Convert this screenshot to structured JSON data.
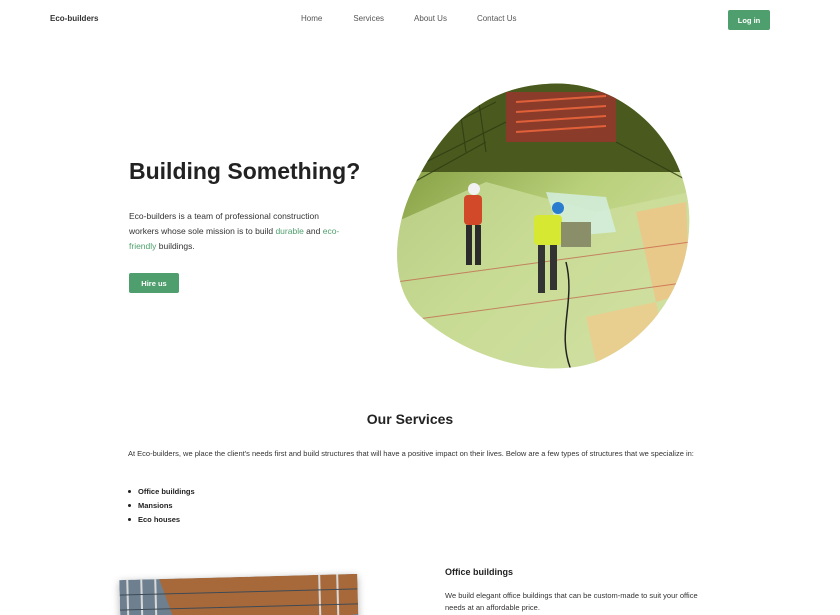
{
  "nav": {
    "brand": "Eco-builders",
    "links": [
      "Home",
      "Services",
      "About Us",
      "Contact Us"
    ],
    "login_label": "Log in"
  },
  "hero": {
    "title": "Building Something?",
    "text_before": "Eco-builders is a team of professional construction workers whose sole mission is to build ",
    "accent_1": "durable",
    "text_mid": " and ",
    "accent_2": "eco-friendly",
    "text_after": " buildings.",
    "cta_label": "Hire us",
    "image_icon": "construction-workers-photo",
    "accent_color": "#4e9f6d"
  },
  "services": {
    "title": "Our Services",
    "intro": "At Eco-builders, we place the client's needs first and build structures that will have a positive impact on their lives. Below are a few types of structures that we specialize in:",
    "items": [
      "Office buildings",
      "Mansions",
      "Eco houses"
    ]
  },
  "office": {
    "title": "Office buildings",
    "text": "We build elegant office buildings that can be custom-made to suit your office needs at an affordable price.",
    "image_icon": "office-building-photo"
  }
}
